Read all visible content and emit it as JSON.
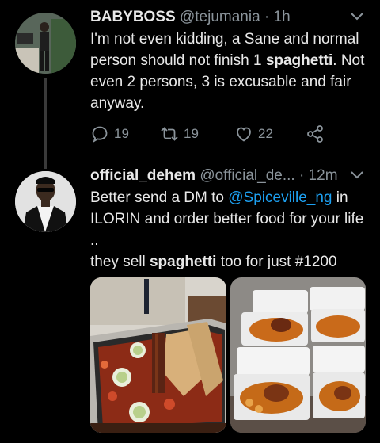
{
  "tweets": [
    {
      "name": "BABYBOSS",
      "handle": "@tejumania",
      "time": "· 1h",
      "text_parts": [
        {
          "t": "I'm not even kidding, a Sane and normal person should not finish 1 "
        },
        {
          "t": "spaghetti",
          "b": true
        },
        {
          "t": ". Not even 2 persons, 3 is excusable and fair anyway."
        }
      ],
      "stats": {
        "replies": "19",
        "retweets": "19",
        "likes": "22"
      }
    },
    {
      "name": "official_dehem",
      "handle": "@official_de...",
      "time": "· 12m",
      "line1_a": "Better send a DM to ",
      "mention": "@Spiceville_ng",
      "line1_b": " in ILORIN and order better food for your life ..",
      "line2_a": "they sell ",
      "line2_bold": "spaghetti",
      "line2_b": " too for just #1200"
    }
  ],
  "icons": {
    "reply": "reply-icon",
    "retweet": "retweet-icon",
    "like": "heart-icon",
    "share": "share-icon",
    "more": "chevron-down-icon"
  },
  "colors": {
    "background": "#000000",
    "text": "#e8e8e8",
    "secondary": "#8b949b",
    "link": "#1da1f2"
  }
}
